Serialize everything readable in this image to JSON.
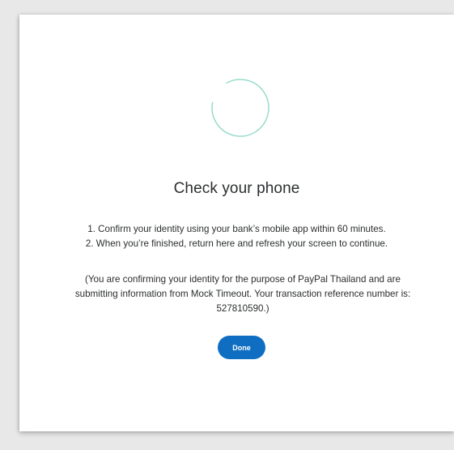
{
  "dialog": {
    "title": "Check your phone",
    "steps": [
      "1. Confirm your identity using your bank’s mobile app within 60 minutes.",
      "2. When you’re finished, return here and refresh your screen to continue."
    ],
    "note": "(You are confirming your identity for the purpose of PayPal Thailand and are submitting information from Mock Timeout. Your transaction reference number is: 527810590.)",
    "done_label": "Done",
    "spinner_icon": "loading-spinner-icon"
  },
  "colors": {
    "background": "#e8e8e8",
    "card": "#ffffff",
    "button": "#0f6ec2",
    "spinner": "#86d5c3",
    "text": "#2c2e2f"
  }
}
